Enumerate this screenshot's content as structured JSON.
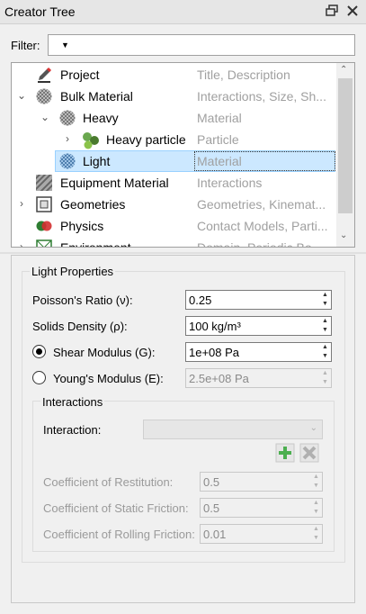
{
  "window": {
    "title": "Creator Tree"
  },
  "filter": {
    "label": "Filter:",
    "value": ""
  },
  "tree": {
    "rows": [
      {
        "name": "Project",
        "desc": "Title, Description"
      },
      {
        "name": "Bulk Material",
        "desc": "Interactions, Size, Sh..."
      },
      {
        "name": "Heavy",
        "desc": "Material"
      },
      {
        "name": "Heavy particle",
        "desc": "Particle"
      },
      {
        "name": "Light",
        "desc": "Material"
      },
      {
        "name": "Equipment Material",
        "desc": "Interactions"
      },
      {
        "name": "Geometries",
        "desc": "Geometries, Kinemat..."
      },
      {
        "name": "Physics",
        "desc": "Contact Models, Parti..."
      },
      {
        "name": "Environment",
        "desc": "Domain, Periodic Bo..."
      }
    ]
  },
  "properties": {
    "group_title": "Light Properties",
    "poisson_label": "Poisson's Ratio (ν):",
    "poisson_value": "0.25",
    "density_label": "Solids Density (ρ):",
    "density_value": "100 kg/m³",
    "shear_label": "Shear Modulus (G):",
    "shear_value": "1e+08 Pa",
    "young_label": "Young's Modulus (E):",
    "young_value": "2.5e+08 Pa",
    "interactions": {
      "title": "Interactions",
      "interaction_label": "Interaction:",
      "interaction_value": "",
      "restitution_label": "Coefficient of Restitution:",
      "restitution_value": "0.5",
      "static_label": "Coefficient of Static Friction:",
      "static_value": "0.5",
      "rolling_label": "Coefficient of Rolling Friction:",
      "rolling_value": "0.01"
    }
  },
  "colors": {
    "selection": "#cce8ff",
    "add_green": "#4caf50"
  }
}
